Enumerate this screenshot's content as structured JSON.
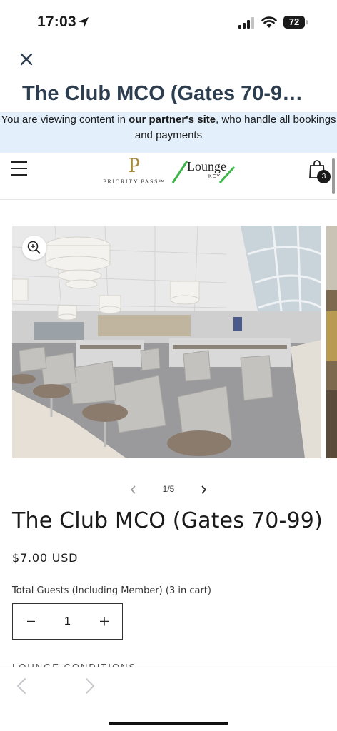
{
  "status_bar": {
    "time": "17:03",
    "battery_level": "72",
    "icons": [
      "location-arrow-icon",
      "signal-icon",
      "wifi-icon",
      "battery-icon"
    ]
  },
  "webview": {
    "title": "The Club MCO (Gates 70-9…",
    "close_icon": "close-icon",
    "banner": {
      "prefix": "You are viewing content in ",
      "partner_link": "our partner's site",
      "suffix": ", who handle all bookings and payments"
    }
  },
  "store_header": {
    "menu_icon": "hamburger-menu-icon",
    "priority_pass_logo": {
      "mark": "P",
      "text": "PRIORITY PASS™"
    },
    "lounge_key_logo": {
      "text": "Lounge",
      "tm": "™",
      "sub": "KEY"
    },
    "cart_count": "3",
    "cart_icon": "shopping-bag-icon"
  },
  "gallery": {
    "current": "1/5",
    "zoom_icon": "zoom-in-icon",
    "prev_icon": "chevron-left-icon",
    "next_icon": "chevron-right-icon"
  },
  "product": {
    "title": "The Club MCO (Gates 70-99)",
    "price": "$7.00 USD",
    "quantity_label": "Total Guests (Including Member) (3 in cart)",
    "quantity_value": "1",
    "cutoff_heading": "LOUNGE CONDITIONS"
  },
  "browser_toolbar": {
    "back_icon": "chevron-left-icon",
    "forward_icon": "chevron-right-icon"
  },
  "colors": {
    "header_title": "#2c3e50",
    "banner_bg": "#e3f0fb",
    "priority_pass_gold": "#a8893f",
    "lounge_key_green": "#3db54a"
  }
}
